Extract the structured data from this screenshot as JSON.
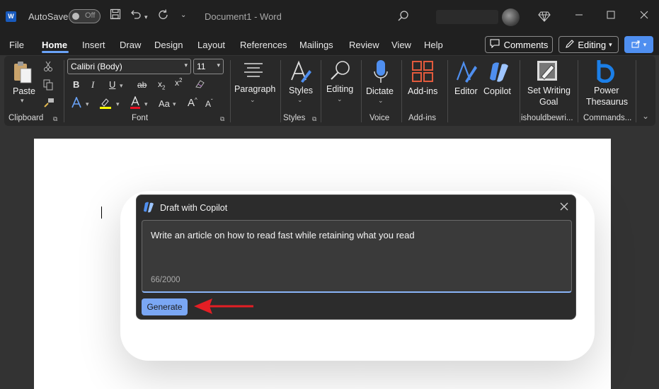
{
  "titlebar": {
    "app_logo": "W",
    "autosave_label": "AutoSave",
    "autosave_state": "Off",
    "document_title": "Document1  -  Word"
  },
  "tabs": [
    "File",
    "Home",
    "Insert",
    "Draw",
    "Design",
    "Layout",
    "References",
    "Mailings",
    "Review",
    "View",
    "Help"
  ],
  "active_tab": "Home",
  "header_buttons": {
    "comments": "Comments",
    "editing": "Editing"
  },
  "ribbon": {
    "clipboard": {
      "paste": "Paste",
      "group": "Clipboard"
    },
    "font": {
      "name": "Calibri (Body)",
      "size": "11",
      "group": "Font"
    },
    "paragraph": {
      "label": "Paragraph"
    },
    "styles": {
      "label": "Styles",
      "group": "Styles"
    },
    "editing": {
      "label": "Editing"
    },
    "voice": {
      "label": "Dictate",
      "group": "Voice"
    },
    "addins": {
      "label": "Add-ins",
      "group": "Add-ins"
    },
    "editor": {
      "label": "Editor"
    },
    "copilot": {
      "label": "Copilot"
    },
    "writing_goal": {
      "label_line1": "Set Writing",
      "label_line2": "Goal",
      "group": "ishouldbewri..."
    },
    "thesaurus": {
      "label_line1": "Power",
      "label_line2": "Thesaurus",
      "group": "Commands..."
    }
  },
  "dialog": {
    "title": "Draft with Copilot",
    "prompt": "Write an article on how to read fast while retaining what you read",
    "counter": "66/2000",
    "generate": "Generate"
  },
  "colors": {
    "accent": "#4f8ff0",
    "generate_button": "#7aa7f4",
    "arrow": "#e31e24",
    "highlight": "#ffff00",
    "font_color": "#e81123"
  }
}
